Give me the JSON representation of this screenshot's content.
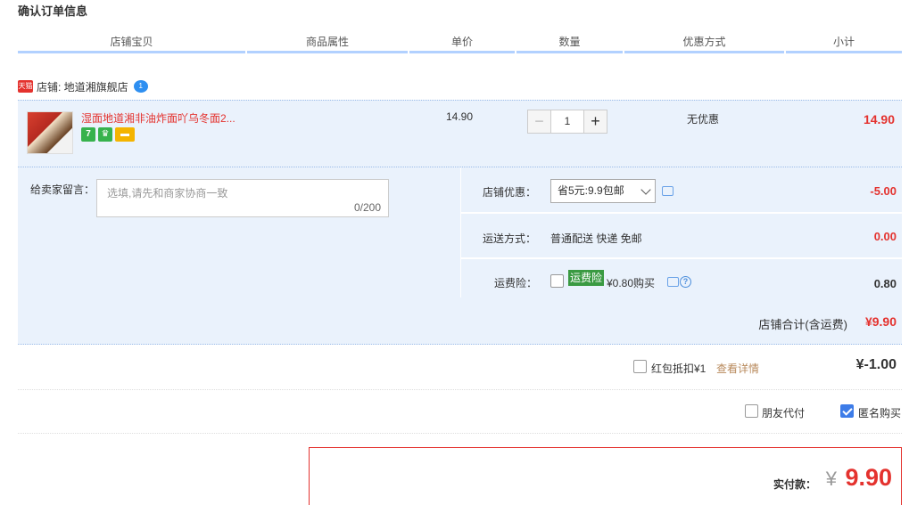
{
  "page_title": "确认订单信息",
  "columns": [
    "店铺宝贝",
    "商品属性",
    "单价",
    "数量",
    "优惠方式",
    "小计"
  ],
  "shop": {
    "badge": "天猫",
    "label": "店铺: 地道湘旗舰店",
    "ww_badge": "1"
  },
  "item": {
    "title": "湿面地道湘非油炸面吖乌冬面2...",
    "badges": [
      "7",
      "♛",
      "▬"
    ],
    "unit_price": "14.90",
    "quantity": "1",
    "minus_label": "−",
    "plus_label": "+",
    "discount_method": "无优惠",
    "subtotal": "14.90"
  },
  "message": {
    "label": "给卖家留言：",
    "placeholder": "选填,请先和商家协商一致",
    "counter": "0/200"
  },
  "shop_discount": {
    "label": "店铺优惠：",
    "selected": "省5元:9.9包邮",
    "value": "-5.00"
  },
  "shipping": {
    "label": "运送方式：",
    "text": "普通配送 快递 免邮",
    "value": "0.00"
  },
  "freight_insurance": {
    "label": "运费险：",
    "tag": "运费险",
    "price_text": "¥0.80购买",
    "help": "?",
    "value": "0.80"
  },
  "store_total": {
    "label": "店铺合计(含运费)",
    "value": "¥9.90"
  },
  "red_packet": {
    "label": "红包抵扣¥1",
    "link": "查看详情",
    "value": "¥-1.00"
  },
  "options": {
    "friend_pay": "朋友代付",
    "anonymous": "匿名购买"
  },
  "payment": {
    "label": "实付款：",
    "currency": "¥",
    "value": "9.90"
  }
}
